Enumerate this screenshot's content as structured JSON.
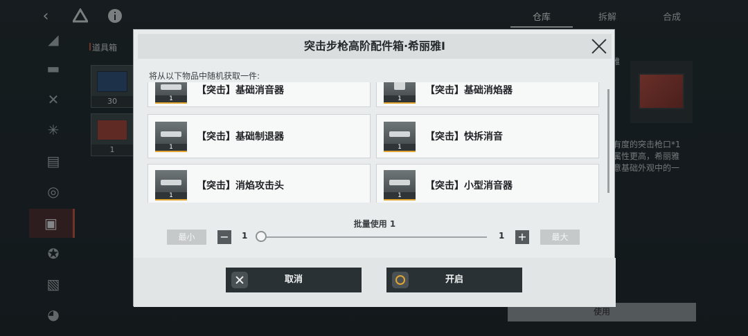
{
  "topbar": {
    "back_icon": "chevron-left-icon",
    "drive_icon": "triangle-logo-icon",
    "info_icon": "info-icon"
  },
  "sidebar": {
    "items": [
      {
        "icon": "pistol-icon"
      },
      {
        "icon": "rifle-icon"
      },
      {
        "icon": "crossed-tools-icon"
      },
      {
        "icon": "burst-icon"
      },
      {
        "icon": "document-lock-icon"
      },
      {
        "icon": "radar-icon"
      },
      {
        "icon": "box-icon",
        "active": true
      },
      {
        "icon": "star-circle-icon"
      },
      {
        "icon": "slash-pattern-icon"
      },
      {
        "icon": "bowl-icon"
      }
    ]
  },
  "right_tabs": [
    {
      "label": "仓库",
      "active": true
    },
    {
      "label": "拆解"
    },
    {
      "label": "合成"
    }
  ],
  "inventory": {
    "label": "道具箱",
    "items": [
      {
        "count": "30"
      },
      {
        "count": "1"
      }
    ]
  },
  "detail": {
    "title_fragment": "雅",
    "desc": "有度的突击枪口*1\n属性更高，希丽雅\n意基础外观中的一",
    "use_label": "使用"
  },
  "modal": {
    "title": "突击步枪高阶配件箱·希丽雅I",
    "subtitle": "将从以下物品中随机获取一件:",
    "rewards": [
      {
        "name": "【突击】基础消音器",
        "qty": "1"
      },
      {
        "name": "【突击】基础消焰器",
        "qty": "1"
      },
      {
        "name": "【突击】基础制退器",
        "qty": "1"
      },
      {
        "name": "【突击】快拆消音",
        "qty": "1"
      },
      {
        "name": "【突击】消焰攻击头",
        "qty": "1"
      },
      {
        "name": "【突击】小型消音器",
        "qty": "1"
      }
    ],
    "batch_label": "批量使用 1",
    "min_label": "最小",
    "max_label": "最大",
    "min_value": "1",
    "max_value": "1",
    "slider_value": 1,
    "cancel_label": "取消",
    "open_label": "开启",
    "accent": "#e3a531"
  }
}
